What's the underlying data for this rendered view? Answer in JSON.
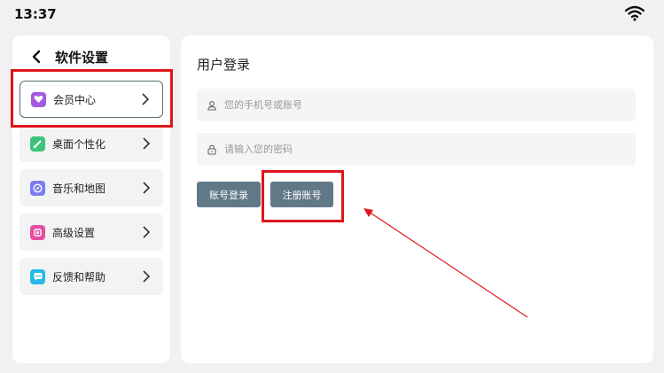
{
  "status_bar": {
    "time": "13:37",
    "wifi_icon": "wifi-icon"
  },
  "sidebar": {
    "title": "软件设置",
    "back_icon": "chevron-left-icon",
    "items": [
      {
        "label": "会员中心",
        "icon": "heart-icon",
        "color": "#a35be0",
        "active": true
      },
      {
        "label": "桌面个性化",
        "icon": "brush-icon",
        "color": "#3cc47c"
      },
      {
        "label": "音乐和地图",
        "icon": "compass-icon",
        "color": "#7a7df0"
      },
      {
        "label": "高级设置",
        "icon": "settings-square-icon",
        "color": "#e64fa0"
      },
      {
        "label": "反馈和帮助",
        "icon": "chat-bubble-icon",
        "color": "#27b7e8"
      }
    ]
  },
  "login": {
    "title": "用户登录",
    "account_placeholder": "您的手机号或账号",
    "password_placeholder": "请输入您的密码",
    "login_button": "账号登录",
    "register_button": "注册账号"
  },
  "colors": {
    "annotation": "#e0151c",
    "button": "#617887"
  }
}
